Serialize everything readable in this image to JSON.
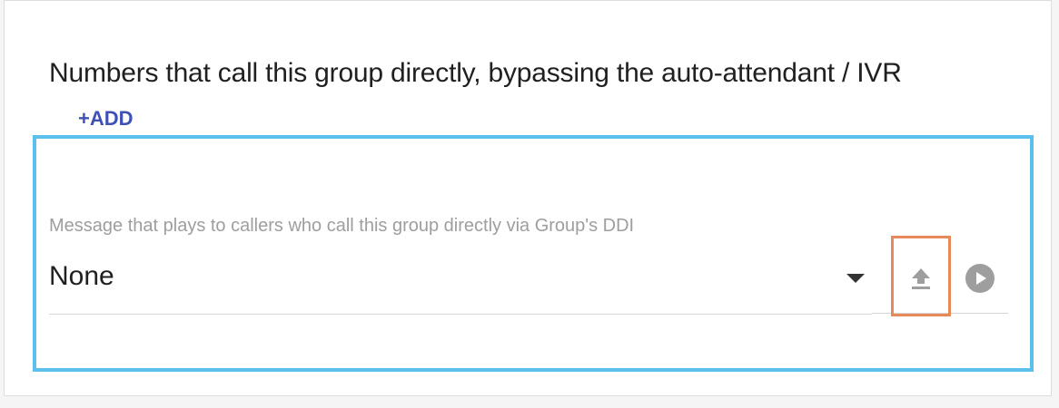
{
  "section": {
    "title": "Numbers that call this group directly, bypassing the auto-attendant / IVR",
    "add_label": "+ADD"
  },
  "message_field": {
    "label": "Message that plays to callers who call this group directly via Group's DDI",
    "selected_value": "None"
  },
  "icons": {
    "dropdown": "chevron-down-icon",
    "upload": "upload-icon",
    "play": "play-icon"
  },
  "colors": {
    "accent": "#3f51b5",
    "highlight_primary": "#5bc0eb",
    "highlight_secondary": "#e8895a",
    "icon_gray": "#9e9e9e"
  }
}
